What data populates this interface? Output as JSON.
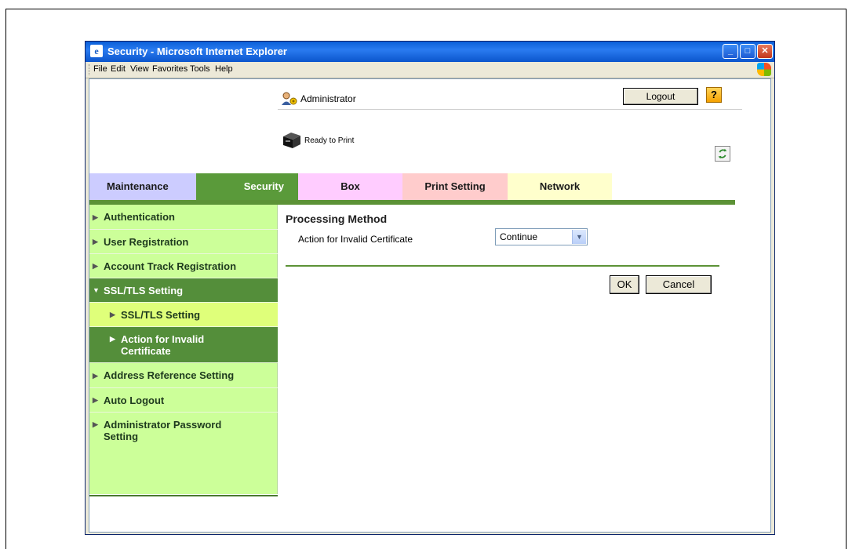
{
  "window": {
    "title": "Security - Microsoft Internet Explorer",
    "controls": {
      "minimize": "_",
      "maximize": "□",
      "close": "✕"
    }
  },
  "menubar": {
    "items": [
      "File",
      "Edit",
      "View",
      "Favorites",
      "Tools",
      "Help"
    ]
  },
  "header": {
    "user": "Administrator",
    "logout_label": "Logout",
    "help_label": "?",
    "status": "Ready to Print"
  },
  "tabs": [
    {
      "label": "Maintenance",
      "color": "#CCCCFF",
      "text_color": "#1a1a1a"
    },
    {
      "label": "Security",
      "color": "#5A9A3A",
      "text_color": "#ffffff"
    },
    {
      "label": "Box",
      "color": "#FFCCFF",
      "text_color": "#1a1a1a"
    },
    {
      "label": "Print Setting",
      "color": "#FFCCCC",
      "text_color": "#1a1a1a"
    },
    {
      "label": "Network",
      "color": "#FFFFCC",
      "text_color": "#1a1a1a"
    }
  ],
  "sidebar": {
    "items": [
      {
        "label": "Authentication",
        "state": "normal"
      },
      {
        "label": "User Registration",
        "state": "normal"
      },
      {
        "label": "Account Track Registration",
        "state": "normal"
      },
      {
        "label": "SSL/TLS Setting",
        "state": "expanded"
      },
      {
        "label": "SSL/TLS Setting",
        "state": "sub-selected"
      },
      {
        "label": "Action for Invalid Certificate",
        "state": "sub-active"
      },
      {
        "label": "Address Reference Setting",
        "state": "normal"
      },
      {
        "label": "Auto Logout",
        "state": "normal"
      },
      {
        "label": "Administrator Password Setting",
        "state": "normal"
      }
    ],
    "colors": {
      "background": "#CCFF99",
      "active": "#548E3A",
      "selected": "#DFFF7A"
    }
  },
  "main": {
    "section_title": "Processing Method",
    "field_label": "Action for Invalid Certificate",
    "field_value": "Continue",
    "ok_label": "OK",
    "cancel_label": "Cancel"
  }
}
